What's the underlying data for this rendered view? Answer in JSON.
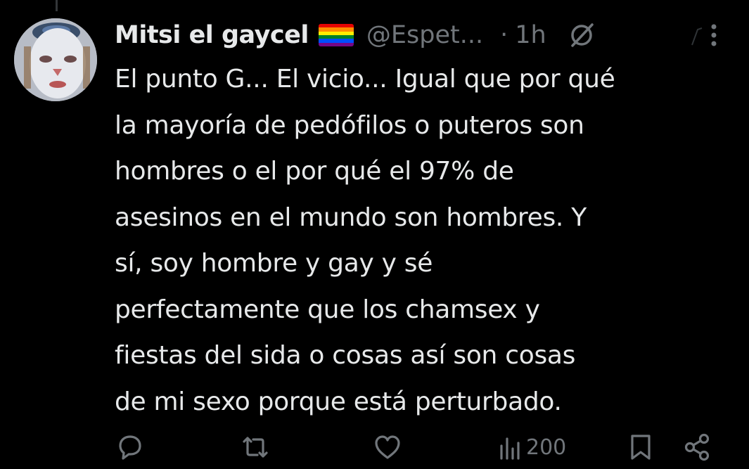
{
  "tweet": {
    "author": {
      "display_name": "Mitsi el gaycel",
      "flag_icon": "rainbow-flag-icon",
      "handle": "@Espet...",
      "avatar_icon": "profile-avatar"
    },
    "separator": "·",
    "time": "1h",
    "text_lines": [
      "El punto G... El vicio... Igual que por qué",
      "la mayoría de pedófilos o puteros son",
      "hombres o el por qué el 97% de",
      "asesinos en el mundo son hombres. Y",
      "sí, soy hombre y gay y sé",
      "perfectamente que los chamsex y",
      "fiestas del sida o cosas así son cosas",
      "de mi sexo porque está perturbado."
    ],
    "actions": {
      "reply_icon": "reply-icon",
      "retweet_icon": "retweet-icon",
      "like_icon": "heart-icon",
      "views_icon": "views-icon",
      "views_count": "200",
      "bookmark_icon": "bookmark-icon",
      "share_icon": "share-icon"
    }
  },
  "colors": {
    "background": "#000000",
    "text_primary": "#e7e9ea",
    "text_secondary": "#71767b"
  }
}
